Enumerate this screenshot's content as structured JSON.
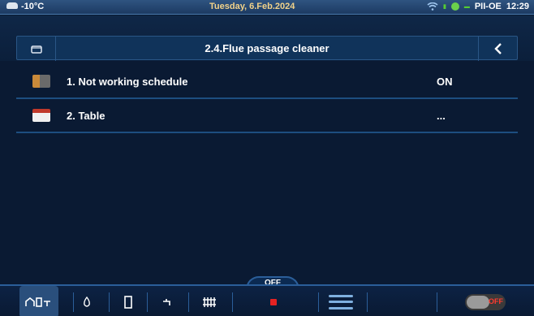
{
  "status_bar": {
    "outdoor_temp": "-10°C",
    "date": "Tuesday, 6.Feb.2024",
    "device": "PII-OE",
    "time": "12:29"
  },
  "header": {
    "title": "2.4.Flue passage cleaner",
    "left_icon": "folder-icon",
    "right_icon": "back-arrow-icon"
  },
  "list": {
    "items": [
      {
        "number": "1.",
        "label": "1. Not working schedule",
        "value": "ON",
        "icon": "schedule-icon"
      },
      {
        "number": "2.",
        "label": "2. Table",
        "value": "...",
        "icon": "calendar-icon"
      }
    ]
  },
  "bottom_nav": {
    "items": [
      "home-icon",
      "flame-icon",
      "boiler-icon",
      "tap-icon",
      "radiator-icon"
    ],
    "mode_tab": "OFF",
    "toggle_label": "OFF",
    "colors": {
      "accent": "#2b5e99",
      "alarm": "#e52222"
    }
  }
}
